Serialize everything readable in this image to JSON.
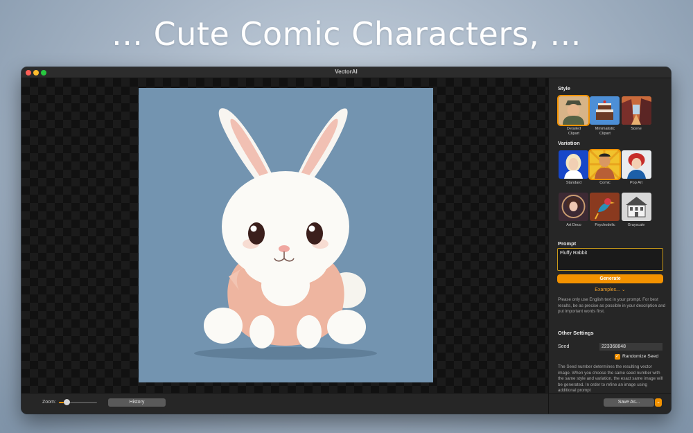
{
  "headline": "... Cute Comic Characters, ...",
  "window": {
    "title": "VectorAI"
  },
  "colors": {
    "accent": "#f39200",
    "image_background": "#7394b0"
  },
  "canvas": {
    "image_subject": "white bunny illustration"
  },
  "bottombar": {
    "zoom_label": "Zoom:",
    "zoom_level": 0.2,
    "history_label": "History"
  },
  "sidebar": {
    "style_title": "Style",
    "styles": [
      {
        "label": "Detailed\nClipart",
        "icon": "detailed-clipart-thumb",
        "selected": true
      },
      {
        "label": "Minimalistic\nClipart",
        "icon": "minimalistic-clipart-thumb",
        "selected": false
      },
      {
        "label": "Scene",
        "icon": "scene-thumb",
        "selected": false
      }
    ],
    "variation_title": "Variation",
    "variations": [
      {
        "label": "Standard",
        "icon": "standard-thumb",
        "selected": false
      },
      {
        "label": "Comic",
        "icon": "comic-thumb",
        "selected": true
      },
      {
        "label": "Pop Art",
        "icon": "pop-art-thumb",
        "selected": false
      },
      {
        "label": "Art Deco",
        "icon": "art-deco-thumb",
        "selected": false
      },
      {
        "label": "Psychodelic",
        "icon": "psychodelic-thumb",
        "selected": false
      },
      {
        "label": "Grayscale",
        "icon": "grayscale-thumb",
        "selected": false
      }
    ],
    "prompt_title": "Prompt",
    "prompt_value": "Fluffy Rabbit",
    "generate_label": "Generate",
    "examples_label": "Examples... ⌄",
    "prompt_help": "Please only use English text in your prompt. For best results, be as precise as possible in your description and put important words first.",
    "other_settings_title": "Other Settings",
    "seed_label": "Seed",
    "seed_value": "223368848",
    "randomize_label": "Randomize Seed",
    "randomize_checked": true,
    "seed_help": "The Seed number determines the resulting vector image. When you choose the same seed number with the same style and variation, the exact same image will be generated. In order to refine an image using additional prompt",
    "save_as_label": "Save As...",
    "save_menu_icon": "chevron-down-icon"
  }
}
